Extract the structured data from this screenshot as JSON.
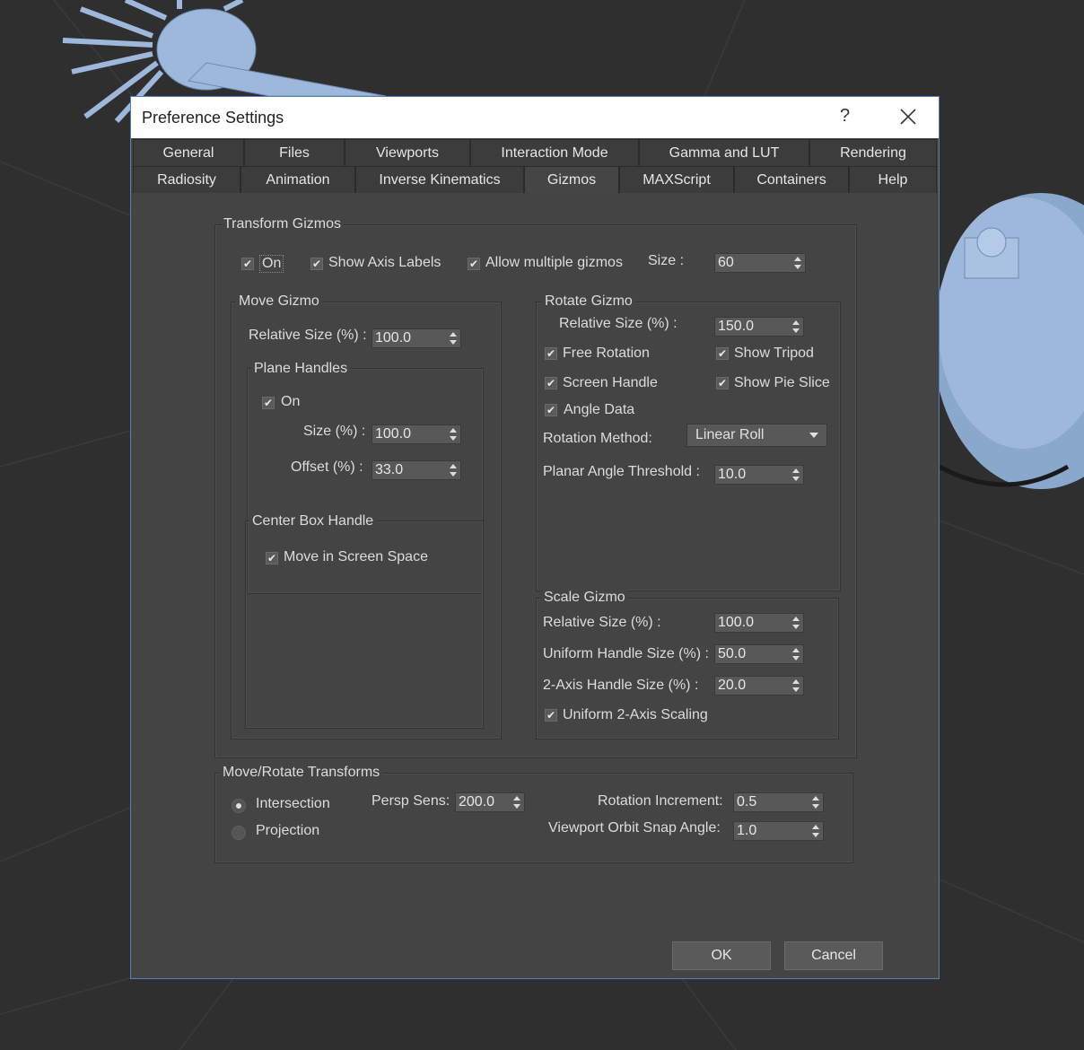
{
  "window": {
    "title": "Preference Settings",
    "help_label": "?"
  },
  "tabs_row1": [
    "General",
    "Files",
    "Viewports",
    "Interaction Mode",
    "Gamma and LUT",
    "Rendering"
  ],
  "tabs_row2": [
    "Radiosity",
    "Animation",
    "Inverse Kinematics",
    "Gizmos",
    "MAXScript",
    "Containers",
    "Help"
  ],
  "active_tab": "Gizmos",
  "transform_gizmos": {
    "label": "Transform Gizmos",
    "on_label": "On",
    "on_checked": true,
    "show_axis_labels_label": "Show Axis Labels",
    "show_axis_labels_checked": true,
    "allow_multiple_label": "Allow multiple gizmos",
    "allow_multiple_checked": true,
    "size_label": "Size :",
    "size_value": "60"
  },
  "move_gizmo": {
    "label": "Move Gizmo",
    "relative_size_label": "Relative Size (%) :",
    "relative_size_value": "100.0",
    "plane_handles": {
      "label": "Plane Handles",
      "on_label": "On",
      "on_checked": true,
      "size_label": "Size (%) :",
      "size_value": "100.0",
      "offset_label": "Offset (%) :",
      "offset_value": "33.0"
    },
    "center_box": {
      "label": "Center Box Handle",
      "move_screen_label": "Move in Screen Space",
      "move_screen_checked": true
    }
  },
  "rotate_gizmo": {
    "label": "Rotate Gizmo",
    "relative_size_label": "Relative Size (%) :",
    "relative_size_value": "150.0",
    "free_rotation_label": "Free Rotation",
    "show_tripod_label": "Show Tripod",
    "screen_handle_label": "Screen Handle",
    "show_pie_slice_label": "Show Pie Slice",
    "angle_data_label": "Angle Data",
    "rotation_method_label": "Rotation Method:",
    "rotation_method_value": "Linear Roll",
    "planar_threshold_label": "Planar Angle Threshold :",
    "planar_threshold_value": "10.0"
  },
  "scale_gizmo": {
    "label": "Scale Gizmo",
    "relative_size_label": "Relative Size (%) :",
    "relative_size_value": "100.0",
    "uniform_handle_label": "Uniform Handle Size (%) :",
    "uniform_handle_value": "50.0",
    "two_axis_label": "2-Axis Handle Size (%) :",
    "two_axis_value": "20.0",
    "uniform_two_axis_label": "Uniform 2-Axis Scaling"
  },
  "move_rotate": {
    "label": "Move/Rotate Transforms",
    "intersection_label": "Intersection",
    "intersection_selected": true,
    "projection_label": "Projection",
    "persp_sens_label": "Persp Sens:",
    "persp_sens_value": "200.0",
    "rotation_increment_label": "Rotation Increment:",
    "rotation_increment_value": "0.5",
    "orbit_snap_label": "Viewport Orbit Snap Angle:",
    "orbit_snap_value": "1.0"
  },
  "buttons": {
    "ok": "OK",
    "cancel": "Cancel"
  },
  "colors": {
    "dialog_bg": "#444444",
    "viewport_bg": "#2f2f2f",
    "model": "#9db8db",
    "border_accent": "#5a7fb0"
  }
}
